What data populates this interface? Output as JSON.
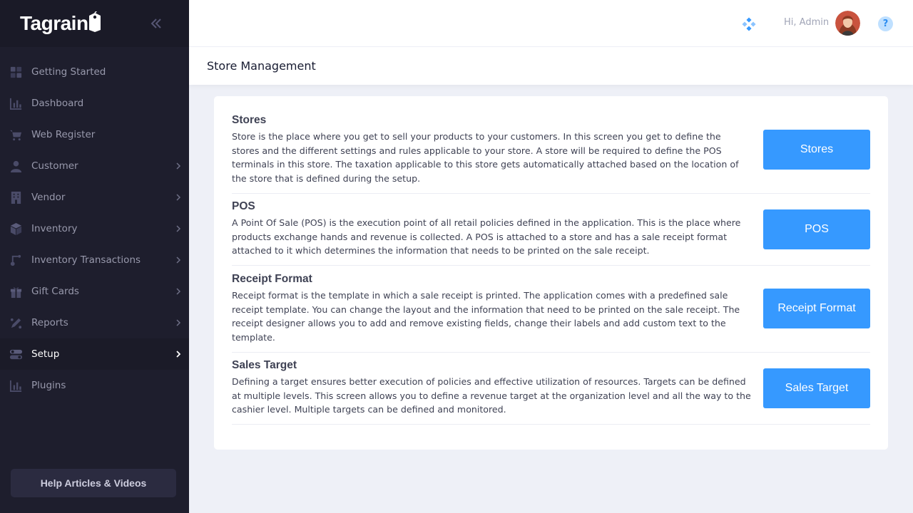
{
  "brand": {
    "name": "Tagrain"
  },
  "sidebar": {
    "items": [
      {
        "label": "Getting Started",
        "icon": "grid-icon",
        "chevron": false
      },
      {
        "label": "Dashboard",
        "icon": "bar-chart-icon",
        "chevron": false
      },
      {
        "label": "Web Register",
        "icon": "cart-icon",
        "chevron": false
      },
      {
        "label": "Customer",
        "icon": "user-icon",
        "chevron": true
      },
      {
        "label": "Vendor",
        "icon": "building-icon",
        "chevron": true
      },
      {
        "label": "Inventory",
        "icon": "box-icon",
        "chevron": true
      },
      {
        "label": "Inventory Transactions",
        "icon": "route-icon",
        "chevron": true
      },
      {
        "label": "Gift Cards",
        "icon": "gift-icon",
        "chevron": true
      },
      {
        "label": "Reports",
        "icon": "pen-icon",
        "chevron": true
      },
      {
        "label": "Setup",
        "icon": "toggle-icon",
        "chevron": true,
        "active": true
      },
      {
        "label": "Plugins",
        "icon": "bar-chart-icon",
        "chevron": false
      }
    ],
    "help_label": "Help Articles & Videos"
  },
  "header": {
    "greeting": "Hi, Admin",
    "help_symbol": "?"
  },
  "page": {
    "title": "Store Management"
  },
  "sections": [
    {
      "title": "Stores",
      "description": "Store is the place where you get to sell your products to your customers. In this screen you get to define the stores and the different settings and rules applicable to your store. A store will be required to define the POS terminals in this store. The taxation applicable to this store gets automatically attached based on the location of the store that is defined during the setup.",
      "button": "Stores"
    },
    {
      "title": "POS",
      "description": "A Point Of Sale (POS) is the execution point of all retail policies defined in the application. This is the place where products exchange hands and revenue is collected. A POS is attached to a store and has a sale receipt format attached to it which determines the information that needs to be printed on the sale receipt.",
      "button": "POS"
    },
    {
      "title": "Receipt Format",
      "description": "Receipt format is the template in which a sale receipt is printed. The application comes with a predefined sale receipt template. You can change the layout and the information that need to be printed on the sale receipt. The receipt designer allows you to add and remove existing fields, change their labels and add custom text to the template.",
      "button": "Receipt Format"
    },
    {
      "title": "Sales Target",
      "description": "Defining a target ensures better execution of policies and effective utilization of resources. Targets can be defined at multiple levels. This screen allows you to define a revenue target at the organization level and all the way to the cashier level. Multiple targets can be defined and monitored.",
      "button": "Sales Target"
    }
  ],
  "colors": {
    "accent": "#3699ff",
    "sidebar": "#1e1e2d",
    "background": "#eef0f7"
  }
}
